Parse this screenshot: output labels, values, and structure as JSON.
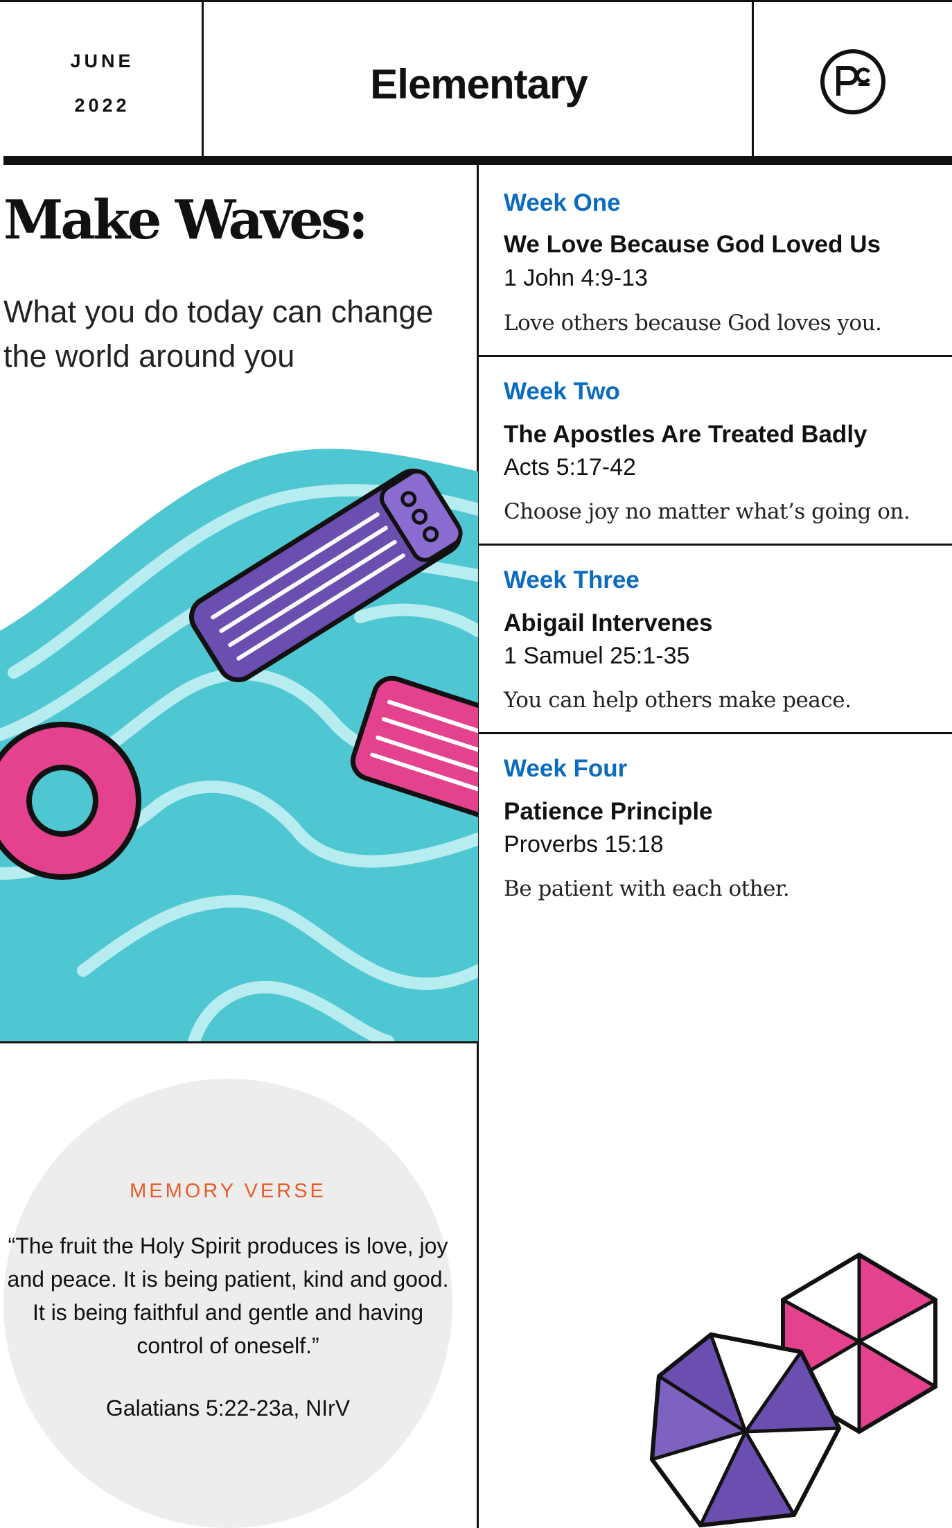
{
  "header": {
    "month": "JUNE",
    "year": "2022",
    "title": "Elementary",
    "logo_text": "PC",
    "logo_icon": "pc-logo-icon"
  },
  "series": {
    "title": "Make Waves:",
    "subtitle": "What you do today can change the world around you"
  },
  "weeks": [
    {
      "label": "Week One",
      "title": "We Love Because God Loved Us",
      "reference": "1 John 4:9-13",
      "takeaway": "Love others because God loves you."
    },
    {
      "label": "Week Two",
      "title": "The Apostles Are Treated Badly",
      "reference": "Acts 5:17-42",
      "takeaway": "Choose joy no matter what’s going on."
    },
    {
      "label": "Week Three",
      "title": "Abigail Intervenes",
      "reference": "1 Samuel 25:1-35",
      "takeaway": "You can help others make peace."
    },
    {
      "label": "Week Four",
      "title": "Patience Principle",
      "reference": "Proverbs 15:18",
      "takeaway": "Be patient with each other."
    }
  ],
  "memory_verse": {
    "label": "MEMORY VERSE",
    "text": "“The fruit the Holy Spirit produces is love, joy and peace. It is being patient, kind and good. It is being faithful and gentle and having control of oneself.”",
    "reference": "Galatians 5:22-23a, NIrV"
  },
  "illustrations": {
    "pool": "pool-illustration",
    "umbrellas": "beach-umbrellas-illustration"
  },
  "colors": {
    "week_label": "#0a6bbf",
    "memory_label": "#ea5b2a",
    "pool_water": "#4fc7d3",
    "float_purple": "#6b4fb0",
    "float_pink": "#e4428f"
  }
}
